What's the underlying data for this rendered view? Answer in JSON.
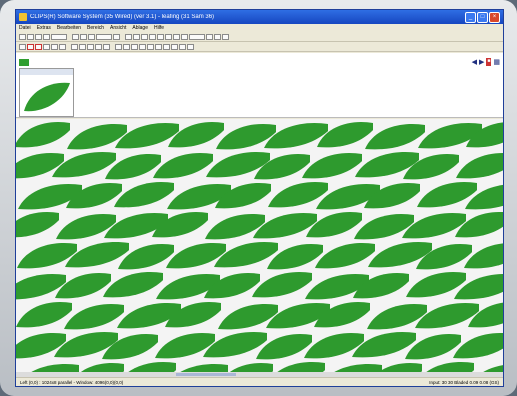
{
  "window": {
    "title": "CLIPS(R) Software System (35 Wired) (ver 3.1) - leafing (31 Sam 36)",
    "controls": [
      "_",
      "□",
      "×"
    ]
  },
  "menu": [
    "Datei",
    "Extras",
    "Bearbeiten",
    "Bereich",
    "Ansicht",
    "Ablage",
    "Hilfe"
  ],
  "status": {
    "left": "Left (0,0) : 1024x8 parallel - Window: 4096(0,0)(0,0)",
    "right": "Input: 30 30 Bladed 0.09 0.08 (GS)"
  },
  "colors": {
    "leaf": "#2e9a2e",
    "canvas": "#f4f4f4"
  }
}
